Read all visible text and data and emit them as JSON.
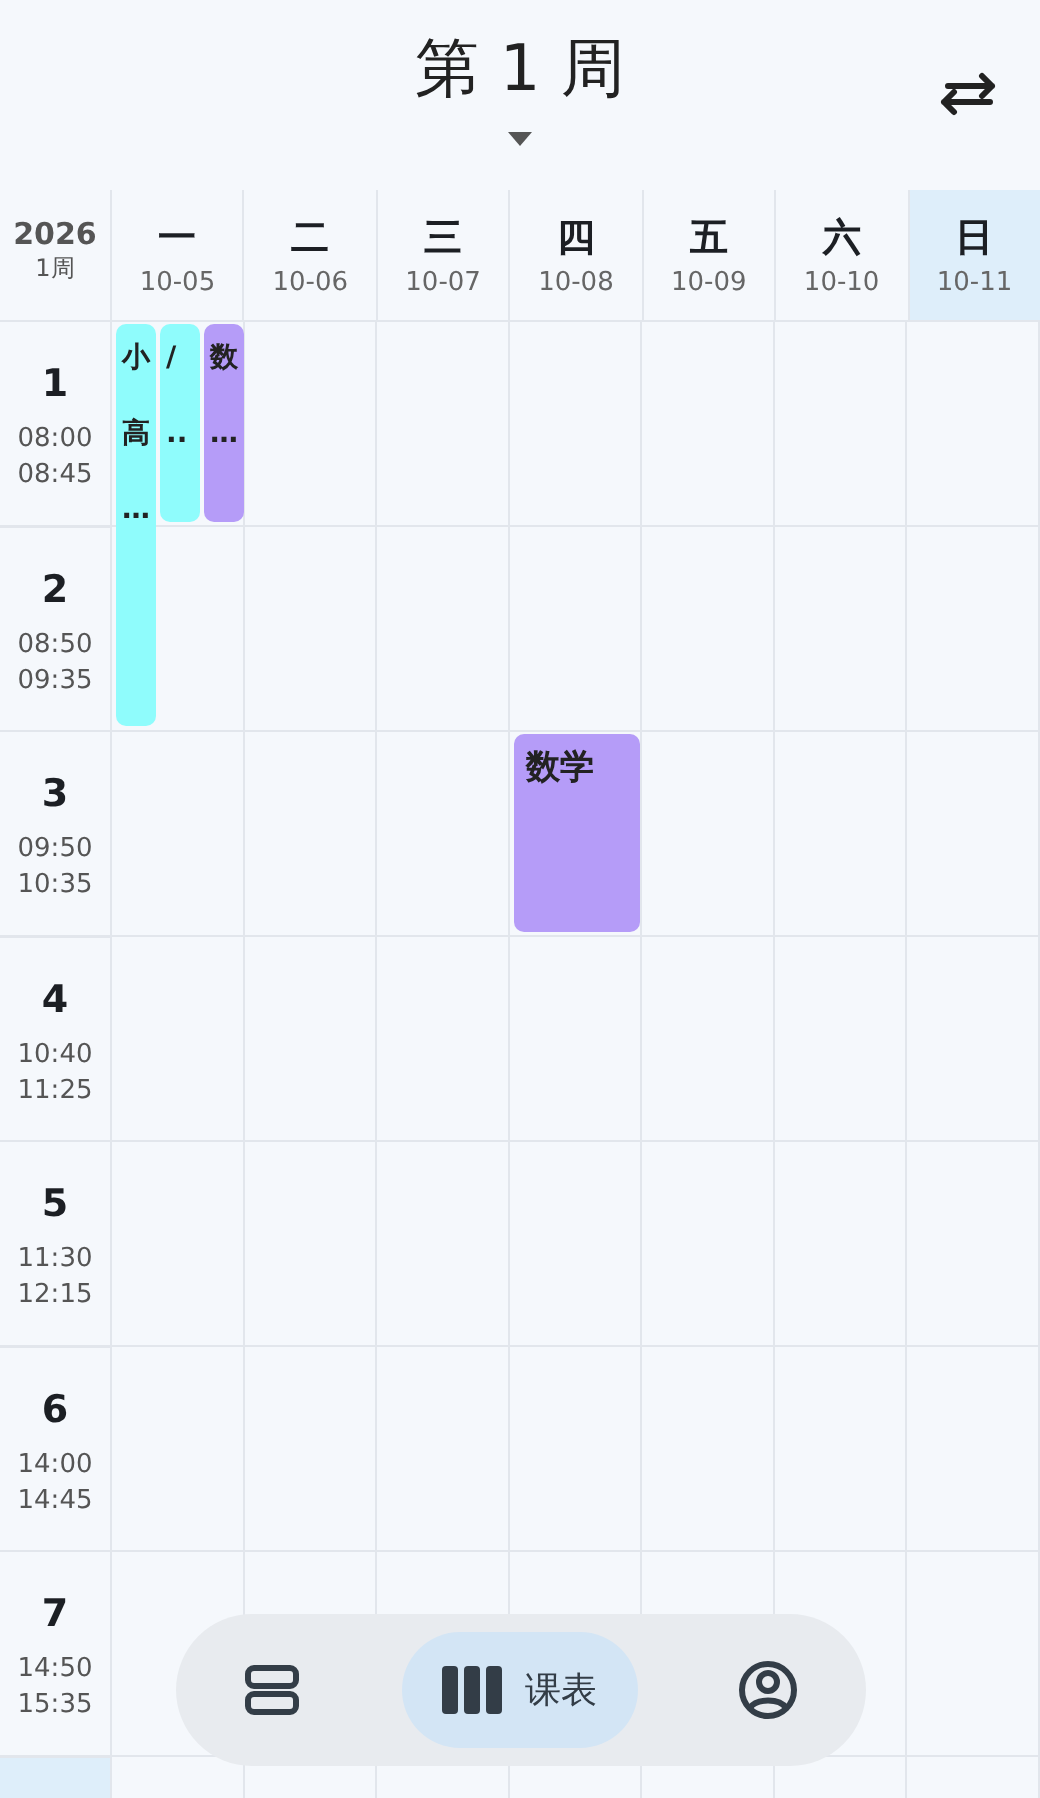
{
  "header": {
    "title": "第 1 周"
  },
  "corner": {
    "year": "2026",
    "week": "1周"
  },
  "days": [
    {
      "name": "一",
      "date": "10-05",
      "selected": false
    },
    {
      "name": "二",
      "date": "10-06",
      "selected": false
    },
    {
      "name": "三",
      "date": "10-07",
      "selected": false
    },
    {
      "name": "四",
      "date": "10-08",
      "selected": false
    },
    {
      "name": "五",
      "date": "10-09",
      "selected": false
    },
    {
      "name": "六",
      "date": "10-10",
      "selected": false
    },
    {
      "name": "日",
      "date": "10-11",
      "selected": true
    }
  ],
  "periods": [
    {
      "number": "1",
      "start": "08:00",
      "end": "08:45"
    },
    {
      "number": "2",
      "start": "08:50",
      "end": "09:35"
    },
    {
      "number": "3",
      "start": "09:50",
      "end": "10:35"
    },
    {
      "number": "4",
      "start": "10:40",
      "end": "11:25"
    },
    {
      "number": "5",
      "start": "11:30",
      "end": "12:15"
    },
    {
      "number": "6",
      "start": "14:00",
      "end": "14:45"
    },
    {
      "number": "7",
      "start": "14:50",
      "end": "15:35"
    }
  ],
  "courses": [
    {
      "lines": [
        "小",
        "高",
        "…"
      ],
      "color": "#8ffcfc"
    },
    {
      "lines": [
        "/",
        ".."
      ],
      "color": "#8ffcfc"
    },
    {
      "lines": [
        "数",
        "…"
      ],
      "color": "#b59cf8"
    },
    {
      "lines": [
        "数学"
      ],
      "color": "#b59cf8"
    }
  ],
  "nav": [
    {
      "kind": "list",
      "selected": false
    },
    {
      "kind": "schedule",
      "label": "课表",
      "selected": true
    },
    {
      "kind": "profile",
      "selected": false
    }
  ]
}
